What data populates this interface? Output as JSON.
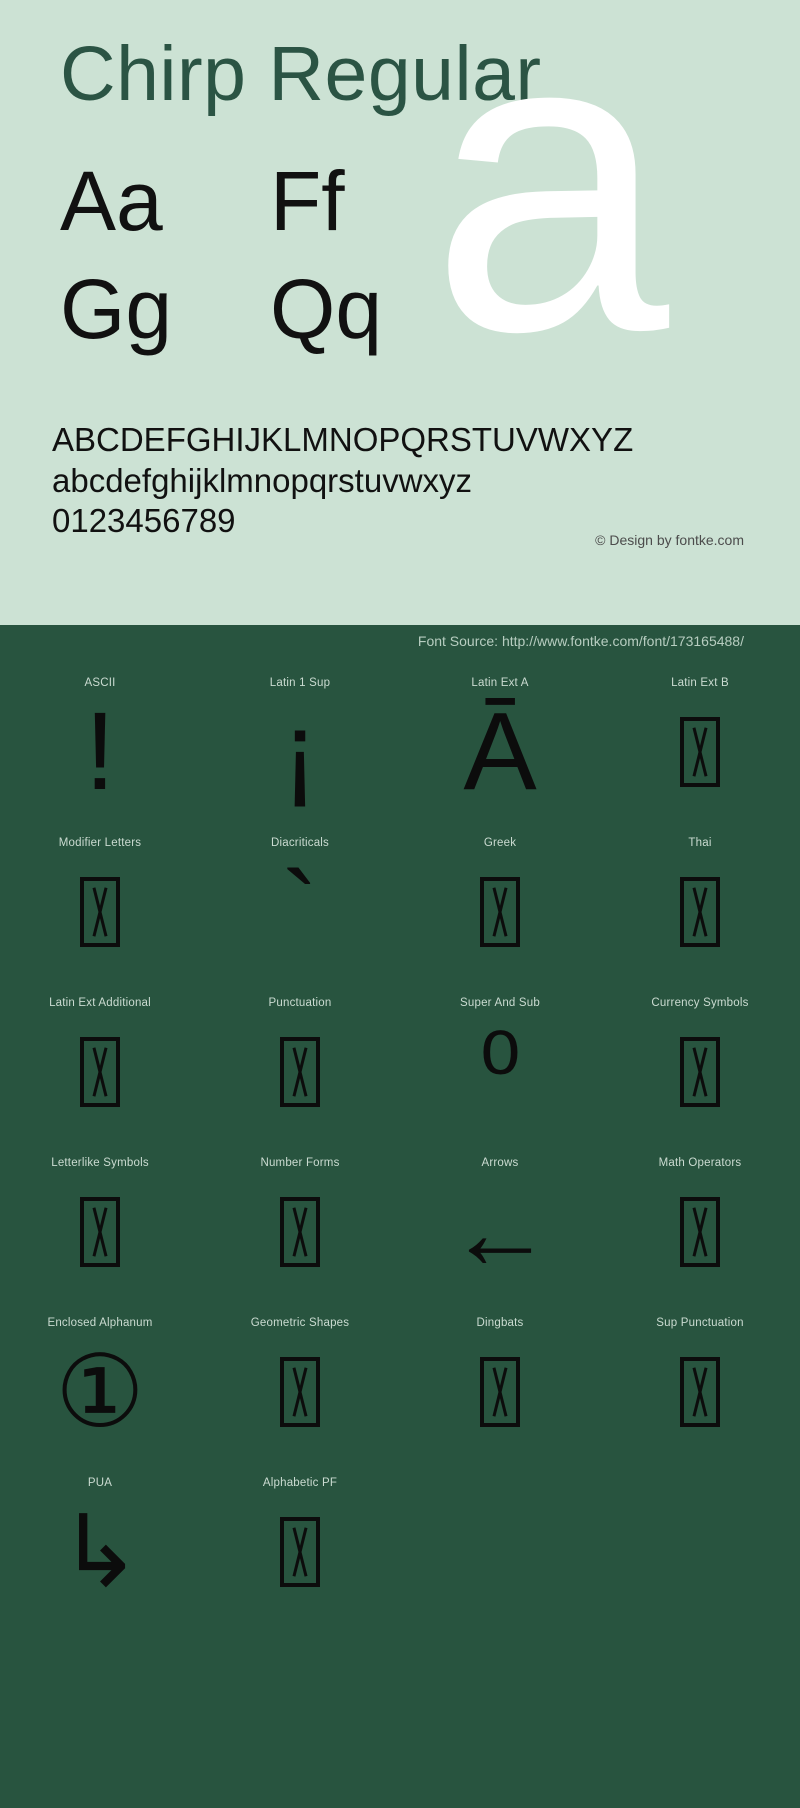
{
  "specimen": {
    "title": "Chirp Regular",
    "waterfall": [
      [
        "Aa",
        "Ff"
      ],
      [
        "Gg",
        "Qq"
      ]
    ],
    "big_glyph": "a",
    "charset": [
      "ABCDEFGHIJKLMNOPQRSTUVWXYZ",
      "abcdefghijklmnopqrstuvwxyz",
      "0123456789"
    ],
    "copyright": "© Design by fontke.com"
  },
  "source": {
    "font_source": "Font Source: http://www.fontke.com/font/173165488/"
  },
  "blocks": [
    {
      "label": "ASCII",
      "glyph": "!",
      "tofu": false,
      "glyph_class": "g-bang"
    },
    {
      "label": "Latin 1 Sup",
      "glyph": "¡",
      "tofu": false,
      "glyph_class": "g-invbang"
    },
    {
      "label": "Latin Ext A",
      "glyph": "Ā",
      "tofu": false,
      "glyph_class": "g-amacron"
    },
    {
      "label": "Latin Ext B",
      "glyph": "",
      "tofu": true,
      "glyph_class": ""
    },
    {
      "label": "Modifier Letters",
      "glyph": "",
      "tofu": true,
      "glyph_class": ""
    },
    {
      "label": "Diacriticals",
      "glyph": "`",
      "tofu": false,
      "glyph_class": "g-bang"
    },
    {
      "label": "Greek",
      "glyph": "",
      "tofu": true,
      "glyph_class": ""
    },
    {
      "label": "Thai",
      "glyph": "",
      "tofu": true,
      "glyph_class": ""
    },
    {
      "label": "Latin Ext Additional",
      "glyph": "",
      "tofu": true,
      "glyph_class": ""
    },
    {
      "label": "Punctuation",
      "glyph": "",
      "tofu": true,
      "glyph_class": ""
    },
    {
      "label": "Super And Sub",
      "glyph": "⁰",
      "tofu": false,
      "glyph_class": "g-sup0"
    },
    {
      "label": "Currency Symbols",
      "glyph": "",
      "tofu": true,
      "glyph_class": ""
    },
    {
      "label": "Letterlike Symbols",
      "glyph": "",
      "tofu": true,
      "glyph_class": ""
    },
    {
      "label": "Number Forms",
      "glyph": "",
      "tofu": true,
      "glyph_class": ""
    },
    {
      "label": "Arrows",
      "glyph": "←",
      "tofu": false,
      "glyph_class": "g-arrow"
    },
    {
      "label": "Math Operators",
      "glyph": "",
      "tofu": true,
      "glyph_class": ""
    },
    {
      "label": "Enclosed Alphanum",
      "glyph": "①",
      "tofu": false,
      "glyph_class": "g-circ1"
    },
    {
      "label": "Geometric Shapes",
      "glyph": "",
      "tofu": true,
      "glyph_class": ""
    },
    {
      "label": "Dingbats",
      "glyph": "",
      "tofu": true,
      "glyph_class": ""
    },
    {
      "label": "Sup Punctuation",
      "glyph": "",
      "tofu": true,
      "glyph_class": ""
    },
    {
      "label": "PUA",
      "glyph": "↳",
      "tofu": false,
      "glyph_class": "g-pua"
    },
    {
      "label": "Alphabetic PF",
      "glyph": "",
      "tofu": true,
      "glyph_class": ""
    }
  ],
  "colors": {
    "light_bg": "#cce2d4",
    "dark_bg": "#28543f",
    "title_green": "#2b5444",
    "glyph_black": "#111111",
    "glyph_white": "#ffffff",
    "label_muted": "#cbdbd1"
  }
}
